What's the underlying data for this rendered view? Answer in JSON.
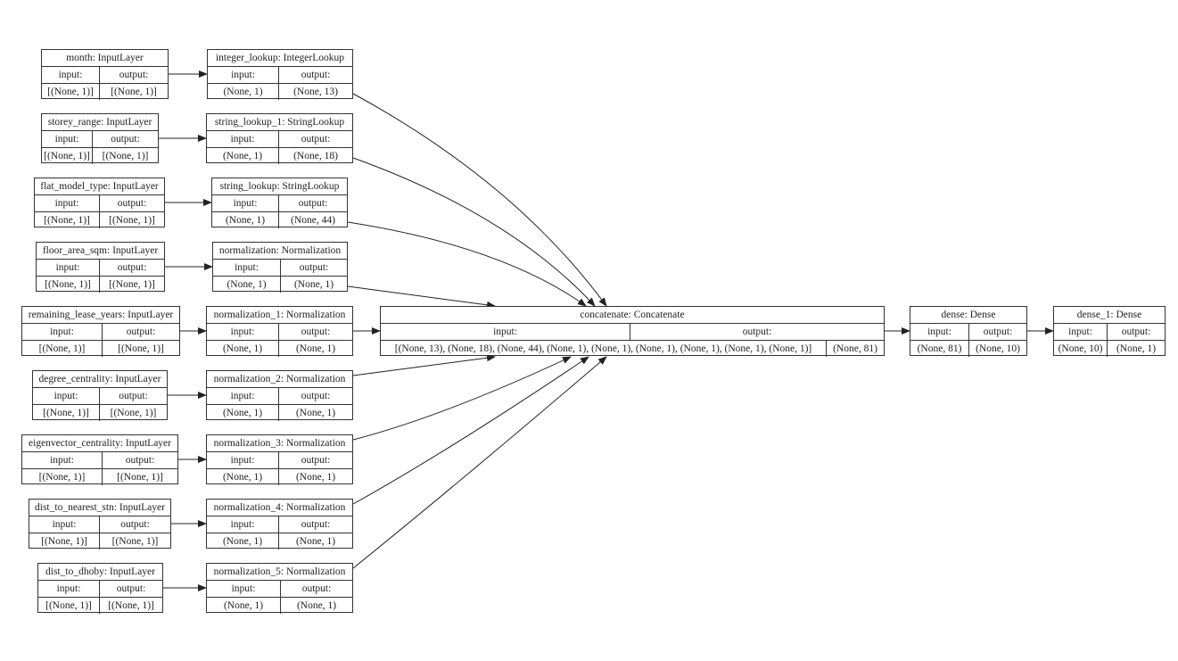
{
  "diagram": {
    "type": "keras-model-plot",
    "labels": {
      "input": "input:",
      "output": "output:"
    },
    "input_layers": [
      {
        "name": "month: InputLayer",
        "input": "[(None, 1)]",
        "output": "[(None, 1)]"
      },
      {
        "name": "storey_range: InputLayer",
        "input": "[(None, 1)]",
        "output": "[(None, 1)]"
      },
      {
        "name": "flat_model_type: InputLayer",
        "input": "[(None, 1)]",
        "output": "[(None, 1)]"
      },
      {
        "name": "floor_area_sqm: InputLayer",
        "input": "[(None, 1)]",
        "output": "[(None, 1)]"
      },
      {
        "name": "remaining_lease_years: InputLayer",
        "input": "[(None, 1)]",
        "output": "[(None, 1)]"
      },
      {
        "name": "degree_centrality: InputLayer",
        "input": "[(None, 1)]",
        "output": "[(None, 1)]"
      },
      {
        "name": "eigenvector_centrality: InputLayer",
        "input": "[(None, 1)]",
        "output": "[(None, 1)]"
      },
      {
        "name": "dist_to_nearest_stn: InputLayer",
        "input": "[(None, 1)]",
        "output": "[(None, 1)]"
      },
      {
        "name": "dist_to_dhoby: InputLayer",
        "input": "[(None, 1)]",
        "output": "[(None, 1)]"
      }
    ],
    "preprocessing_layers": [
      {
        "name": "integer_lookup: IntegerLookup",
        "input": "(None, 1)",
        "output": "(None, 13)"
      },
      {
        "name": "string_lookup_1: StringLookup",
        "input": "(None, 1)",
        "output": "(None, 18)"
      },
      {
        "name": "string_lookup: StringLookup",
        "input": "(None, 1)",
        "output": "(None, 44)"
      },
      {
        "name": "normalization: Normalization",
        "input": "(None, 1)",
        "output": "(None, 1)"
      },
      {
        "name": "normalization_1: Normalization",
        "input": "(None, 1)",
        "output": "(None, 1)"
      },
      {
        "name": "normalization_2: Normalization",
        "input": "(None, 1)",
        "output": "(None, 1)"
      },
      {
        "name": "normalization_3: Normalization",
        "input": "(None, 1)",
        "output": "(None, 1)"
      },
      {
        "name": "normalization_4: Normalization",
        "input": "(None, 1)",
        "output": "(None, 1)"
      },
      {
        "name": "normalization_5: Normalization",
        "input": "(None, 1)",
        "output": "(None, 1)"
      }
    ],
    "concatenate": {
      "name": "concatenate: Concatenate",
      "input": "[(None, 13), (None, 18), (None, 44), (None, 1), (None, 1), (None, 1), (None, 1), (None, 1), (None, 1)]",
      "output": "(None, 81)"
    },
    "dense_layers": [
      {
        "name": "dense: Dense",
        "input": "(None, 81)",
        "output": "(None, 10)"
      },
      {
        "name": "dense_1: Dense",
        "input": "(None, 10)",
        "output": "(None, 1)"
      }
    ]
  }
}
